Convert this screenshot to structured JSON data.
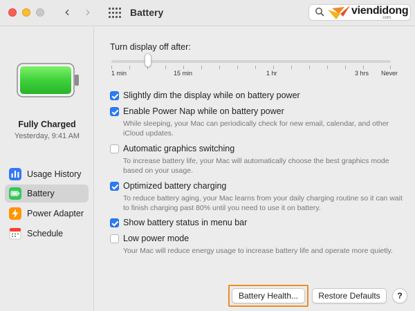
{
  "window": {
    "title": "Battery",
    "back_glyph": "‹",
    "forward_glyph": "›"
  },
  "watermark": {
    "brand": "viendidong",
    "sub": ".com"
  },
  "sidebar": {
    "battery_level": 1.0,
    "charge_status": "Fully Charged",
    "charge_time": "Yesterday, 9:41 AM",
    "items": [
      {
        "label": "Usage History",
        "icon": "usage-history-icon",
        "active": false
      },
      {
        "label": "Battery",
        "icon": "battery-icon",
        "active": true
      },
      {
        "label": "Power Adapter",
        "icon": "power-adapter-icon",
        "active": false
      },
      {
        "label": "Schedule",
        "icon": "schedule-icon",
        "active": false
      }
    ]
  },
  "main": {
    "display_off": {
      "label": "Turn display off after:",
      "ticks": [
        "1 min",
        "15 min",
        "1 hr",
        "3 hrs",
        "Never"
      ],
      "selected_value": "5 min"
    },
    "options": [
      {
        "label": "Slightly dim the display while on battery power",
        "checked": true,
        "description": ""
      },
      {
        "label": "Enable Power Nap while on battery power",
        "checked": true,
        "description": "While sleeping, your Mac can periodically check for new email, calendar, and other iCloud updates."
      },
      {
        "label": "Automatic graphics switching",
        "checked": false,
        "description": "To increase battery life, your Mac will automatically choose the best graphics mode based on your usage."
      },
      {
        "label": "Optimized battery charging",
        "checked": true,
        "description": "To reduce battery aging, your Mac learns from your daily charging routine so it can wait to finish charging past 80% until you need to use it on battery."
      },
      {
        "label": "Show battery status in menu bar",
        "checked": true,
        "description": ""
      },
      {
        "label": "Low power mode",
        "checked": false,
        "description": "Your Mac will reduce energy usage to increase battery life and operate more quietly."
      }
    ]
  },
  "footer": {
    "battery_health": "Battery Health...",
    "restore_defaults": "Restore Defaults",
    "help": "?"
  },
  "colors": {
    "accent": "#2c7cf6",
    "battery_green": "#3fd13a",
    "highlight_orange": "#f08a24"
  }
}
